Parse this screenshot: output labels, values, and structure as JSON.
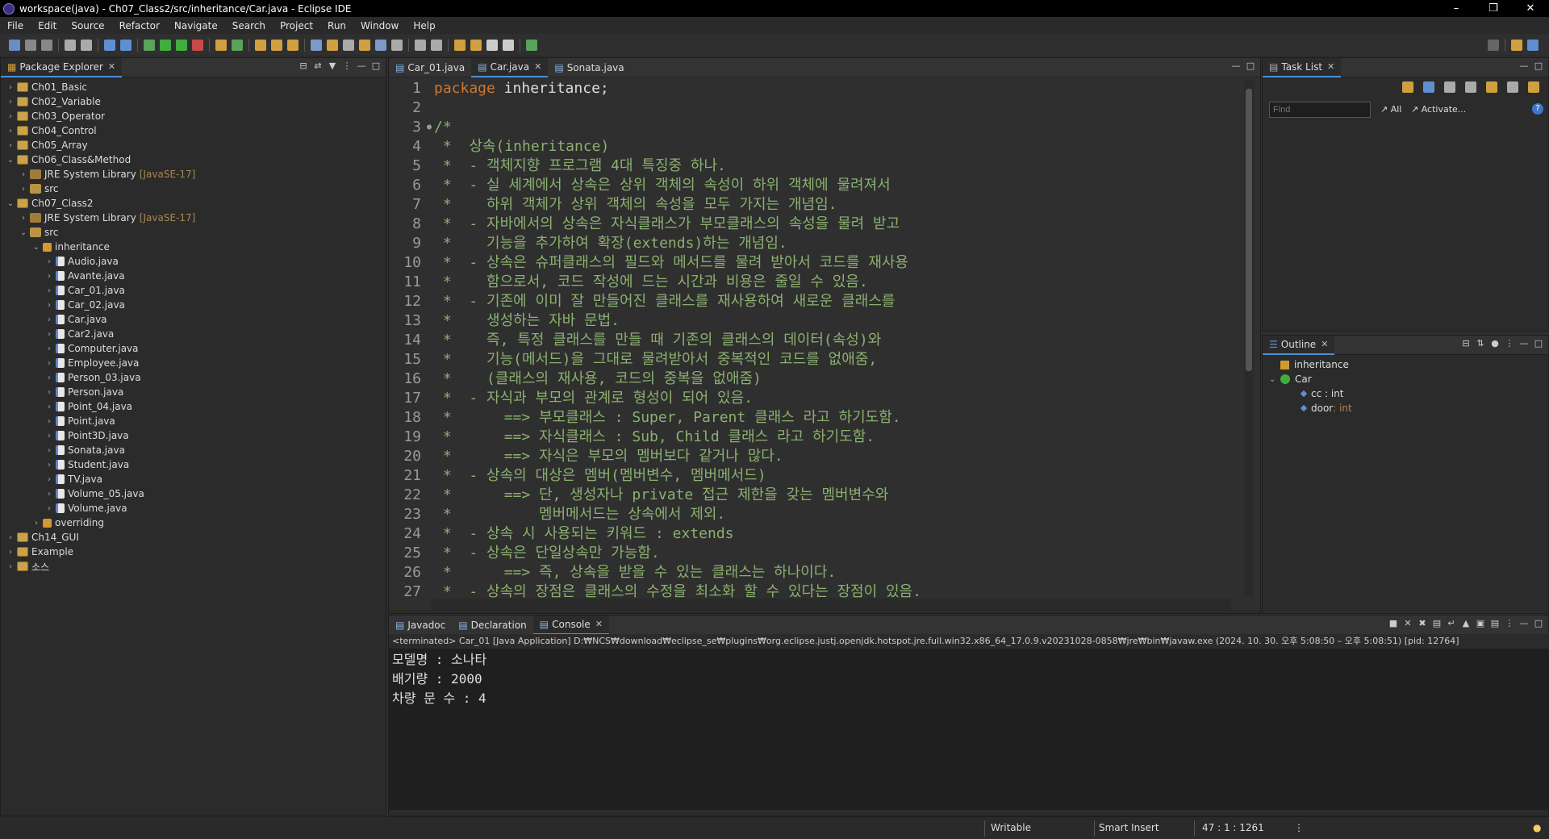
{
  "window": {
    "title": "workspace(java) - Ch07_Class2/src/inheritance/Car.java - Eclipse IDE"
  },
  "menu": [
    "File",
    "Edit",
    "Source",
    "Refactor",
    "Navigate",
    "Search",
    "Project",
    "Run",
    "Window",
    "Help"
  ],
  "package_explorer": {
    "tab": "Package Explorer",
    "tree": [
      {
        "label": "Ch01_Basic",
        "level": 0,
        "type": "proj",
        "arrow": "›"
      },
      {
        "label": "Ch02_Variable",
        "level": 0,
        "type": "proj",
        "arrow": "›"
      },
      {
        "label": "Ch03_Operator",
        "level": 0,
        "type": "proj",
        "arrow": "›"
      },
      {
        "label": "Ch04_Control",
        "level": 0,
        "type": "proj",
        "arrow": "›"
      },
      {
        "label": "Ch05_Array",
        "level": 0,
        "type": "proj",
        "arrow": "›"
      },
      {
        "label": "Ch06_Class&Method",
        "level": 0,
        "type": "proj",
        "arrow": "⌄"
      },
      {
        "label": "JRE System Library",
        "suffix": "[JavaSE-17]",
        "level": 1,
        "type": "lib",
        "arrow": "›"
      },
      {
        "label": "src",
        "level": 1,
        "type": "src",
        "arrow": "›"
      },
      {
        "label": "Ch07_Class2",
        "level": 0,
        "type": "proj",
        "arrow": "⌄"
      },
      {
        "label": "JRE System Library",
        "suffix": "[JavaSE-17]",
        "level": 1,
        "type": "lib",
        "arrow": "›"
      },
      {
        "label": "src",
        "level": 1,
        "type": "src",
        "arrow": "⌄"
      },
      {
        "label": "inheritance",
        "level": 2,
        "type": "pkg",
        "arrow": "⌄"
      },
      {
        "label": "Audio.java",
        "level": 3,
        "type": "java",
        "arrow": "›"
      },
      {
        "label": "Avante.java",
        "level": 3,
        "type": "java",
        "arrow": "›"
      },
      {
        "label": "Car_01.java",
        "level": 3,
        "type": "java",
        "arrow": "›"
      },
      {
        "label": "Car_02.java",
        "level": 3,
        "type": "java",
        "arrow": "›"
      },
      {
        "label": "Car.java",
        "level": 3,
        "type": "java",
        "arrow": "›"
      },
      {
        "label": "Car2.java",
        "level": 3,
        "type": "java",
        "arrow": "›"
      },
      {
        "label": "Computer.java",
        "level": 3,
        "type": "java",
        "arrow": "›"
      },
      {
        "label": "Employee.java",
        "level": 3,
        "type": "java",
        "arrow": "›"
      },
      {
        "label": "Person_03.java",
        "level": 3,
        "type": "java",
        "arrow": "›"
      },
      {
        "label": "Person.java",
        "level": 3,
        "type": "java",
        "arrow": "›"
      },
      {
        "label": "Point_04.java",
        "level": 3,
        "type": "java",
        "arrow": "›"
      },
      {
        "label": "Point.java",
        "level": 3,
        "type": "java",
        "arrow": "›"
      },
      {
        "label": "Point3D.java",
        "level": 3,
        "type": "java",
        "arrow": "›"
      },
      {
        "label": "Sonata.java",
        "level": 3,
        "type": "java",
        "arrow": "›"
      },
      {
        "label": "Student.java",
        "level": 3,
        "type": "java",
        "arrow": "›"
      },
      {
        "label": "TV.java",
        "level": 3,
        "type": "java",
        "arrow": "›"
      },
      {
        "label": "Volume_05.java",
        "level": 3,
        "type": "java",
        "arrow": "›"
      },
      {
        "label": "Volume.java",
        "level": 3,
        "type": "java",
        "arrow": "›"
      },
      {
        "label": "overriding",
        "level": 2,
        "type": "pkg",
        "arrow": "›"
      },
      {
        "label": "Ch14_GUI",
        "level": 0,
        "type": "proj",
        "arrow": "›"
      },
      {
        "label": "Example",
        "level": 0,
        "type": "proj",
        "arrow": "›"
      },
      {
        "label": "소스",
        "level": 0,
        "type": "proj",
        "arrow": "›"
      }
    ]
  },
  "editor": {
    "tabs": [
      {
        "label": "Car_01.java",
        "active": false
      },
      {
        "label": "Car.java",
        "active": true
      },
      {
        "label": "Sonata.java",
        "active": false
      }
    ],
    "lines": [
      {
        "n": "1",
        "kind": "pkg",
        "text": "package inheritance;"
      },
      {
        "n": "2",
        "kind": "tx",
        "text": ""
      },
      {
        "n": "3",
        "kind": "ct",
        "text": "/*",
        "marker": "●"
      },
      {
        "n": "4",
        "kind": "ct",
        "text": " *  상속(inheritance)"
      },
      {
        "n": "5",
        "kind": "ct",
        "text": " *  - 객체지향 프로그램 4대 특징중 하나."
      },
      {
        "n": "6",
        "kind": "ct",
        "text": " *  - 실 세계에서 상속은 상위 객체의 속성이 하위 객체에 물려져서"
      },
      {
        "n": "7",
        "kind": "ct",
        "text": " *    하위 객체가 상위 객체의 속성을 모두 가지는 개념임."
      },
      {
        "n": "8",
        "kind": "ct",
        "text": " *  - 자바에서의 상속은 자식클래스가 부모클래스의 속성을 물려 받고"
      },
      {
        "n": "9",
        "kind": "ct",
        "text": " *    기능을 추가하여 확장(extends)하는 개념임."
      },
      {
        "n": "10",
        "kind": "ct",
        "text": " *  - 상속은 슈퍼클래스의 필드와 메서드를 물려 받아서 코드를 재사용"
      },
      {
        "n": "11",
        "kind": "ct",
        "text": " *    함으로서, 코드 작성에 드는 시간과 비용은 줄일 수 있음."
      },
      {
        "n": "12",
        "kind": "ct",
        "text": " *  - 기존에 이미 잘 만들어진 클래스를 재사용하여 새로운 클래스를"
      },
      {
        "n": "13",
        "kind": "ct",
        "text": " *    생성하는 자바 문법."
      },
      {
        "n": "14",
        "kind": "ct",
        "text": " *    즉, 특정 클래스를 만들 때 기존의 클래스의 데이터(속성)와"
      },
      {
        "n": "15",
        "kind": "ct",
        "text": " *    기능(메서드)을 그대로 물려받아서 중복적인 코드를 없애줌,"
      },
      {
        "n": "16",
        "kind": "ct",
        "text": " *    (클래스의 재사용, 코드의 중복을 없애줌)"
      },
      {
        "n": "17",
        "kind": "ct",
        "text": " *  - 자식과 부모의 관계로 형성이 되어 있음."
      },
      {
        "n": "18",
        "kind": "ct",
        "text": " *      ==> 부모클래스 : Super, Parent 클래스 라고 하기도함."
      },
      {
        "n": "19",
        "kind": "ct",
        "text": " *      ==> 자식클래스 : Sub, Child 클래스 라고 하기도함."
      },
      {
        "n": "20",
        "kind": "ct",
        "text": " *      ==> 자식은 부모의 멤버보다 같거나 많다."
      },
      {
        "n": "21",
        "kind": "ct",
        "text": " *  - 상속의 대상은 멤버(멤버변수, 멤버메서드)"
      },
      {
        "n": "22",
        "kind": "ct",
        "text": " *      ==> 단, 생성자나 private 접근 제한을 갖는 멤버변수와"
      },
      {
        "n": "23",
        "kind": "ct",
        "text": " *          멤버메서드는 상속에서 제외."
      },
      {
        "n": "24",
        "kind": "ct",
        "text": " *  - 상속 시 사용되는 키워드 : extends"
      },
      {
        "n": "25",
        "kind": "ct",
        "text": " *  - 상속은 단일상속만 가능함."
      },
      {
        "n": "26",
        "kind": "ct",
        "text": " *      ==> 즉, 상속을 받을 수 있는 클래스는 하나이다."
      },
      {
        "n": "27",
        "kind": "ct",
        "text": " *  - 상속의 장점은 클래스의 수정을 최소화 할 수 있다는 장점이 있음."
      }
    ]
  },
  "task_list": {
    "tab": "Task List",
    "find_placeholder": "Find",
    "all_label": "All",
    "activate_label": "Activate..."
  },
  "outline": {
    "tab": "Outline",
    "items": [
      {
        "label": "inheritance",
        "level": 0,
        "type": "pkg"
      },
      {
        "label": "Car",
        "level": 0,
        "type": "class",
        "arrow": "⌄"
      },
      {
        "label": "cc : int",
        "level": 1,
        "type": "field"
      },
      {
        "label": "door",
        "suffix": " : int",
        "level": 1,
        "type": "field"
      }
    ]
  },
  "console": {
    "tabs": [
      {
        "label": "Javadoc",
        "active": false
      },
      {
        "label": "Declaration",
        "active": false
      },
      {
        "label": "Console",
        "active": true
      }
    ],
    "header": "<terminated> Car_01 [Java Application] D:₩NCS₩download₩eclipse_se₩plugins₩org.eclipse.justj.openjdk.hotspot.jre.full.win32.x86_64_17.0.9.v20231028-0858₩jre₩bin₩javaw.exe (2024. 10. 30. 오후 5:08:50 – 오후 5:08:51) [pid: 12764]",
    "output": [
      "모델명 : 소나타",
      "배기량 : 2000",
      "차량 문 수 : 4"
    ]
  },
  "status": {
    "mode": "Writable",
    "insert": "Smart Insert",
    "position": "47 : 1 : 1261"
  }
}
